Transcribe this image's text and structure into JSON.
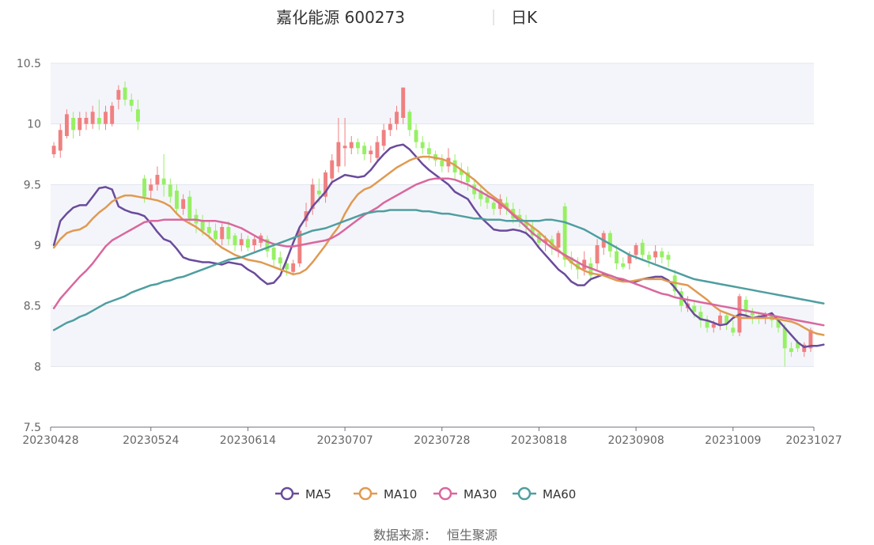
{
  "chart_data": {
    "type": "candlestick",
    "title": "嘉化能源 600273",
    "subtitle": "日K",
    "source_label": "数据来源：",
    "source_name": "恒生聚源",
    "ylim": [
      7.5,
      10.5
    ],
    "y_ticks": [
      "7.5",
      "8",
      "8.5",
      "9",
      "9.5",
      "10",
      "10.5"
    ],
    "x_ticks": [
      {
        "label": "20230428",
        "index": 0
      },
      {
        "label": "20230524",
        "index": 15
      },
      {
        "label": "20230614",
        "index": 30
      },
      {
        "label": "20230707",
        "index": 45
      },
      {
        "label": "20230728",
        "index": 60
      },
      {
        "label": "20230818",
        "index": 75
      },
      {
        "label": "20230908",
        "index": 90
      },
      {
        "label": "20231009",
        "index": 105
      },
      {
        "label": "20231027",
        "index": 119
      }
    ],
    "grid": true,
    "legend_position": "bottom",
    "colors": {
      "up": "#f08080",
      "down": "#96f064",
      "MA5": "#6a4b9c",
      "MA10": "#e09a52",
      "MA30": "#d9679e",
      "MA60": "#4f9ea0"
    },
    "candles": [
      [
        9.75,
        9.82,
        9.72,
        9.85
      ],
      [
        9.78,
        9.95,
        9.72,
        10.0
      ],
      [
        9.9,
        10.08,
        9.88,
        10.12
      ],
      [
        10.05,
        9.95,
        9.88,
        10.1
      ],
      [
        9.95,
        10.05,
        9.9,
        10.1
      ],
      [
        10.0,
        10.05,
        9.95,
        10.1
      ],
      [
        10.0,
        10.1,
        9.96,
        10.15
      ],
      [
        10.05,
        10.0,
        9.95,
        10.2
      ],
      [
        10.0,
        10.1,
        9.95,
        10.15
      ],
      [
        10.0,
        10.15,
        9.98,
        10.18
      ],
      [
        10.2,
        10.28,
        10.12,
        10.32
      ],
      [
        10.3,
        10.2,
        10.15,
        10.35
      ],
      [
        10.2,
        10.15,
        10.1,
        10.25
      ],
      [
        10.12,
        10.02,
        9.95,
        10.2
      ],
      [
        9.55,
        9.4,
        9.35,
        9.58
      ],
      [
        9.45,
        9.5,
        9.38,
        9.55
      ],
      [
        9.5,
        9.58,
        9.45,
        9.65
      ],
      [
        9.55,
        9.5,
        9.4,
        9.75
      ],
      [
        9.5,
        9.4,
        9.35,
        9.55
      ],
      [
        9.45,
        9.3,
        9.25,
        9.5
      ],
      [
        9.3,
        9.38,
        9.25,
        9.42
      ],
      [
        9.4,
        9.22,
        9.18,
        9.45
      ],
      [
        9.25,
        9.18,
        9.1,
        9.3
      ],
      [
        9.2,
        9.12,
        9.08,
        9.25
      ],
      [
        9.15,
        9.1,
        9.05,
        9.2
      ],
      [
        9.12,
        9.05,
        9.0,
        9.18
      ],
      [
        9.05,
        9.15,
        9.0,
        9.18
      ],
      [
        9.15,
        9.05,
        9.0,
        9.2
      ],
      [
        9.08,
        9.0,
        8.95,
        9.1
      ],
      [
        9.0,
        9.05,
        8.95,
        9.1
      ],
      [
        9.05,
        8.98,
        8.95,
        9.08
      ],
      [
        9.0,
        9.05,
        8.95,
        9.08
      ],
      [
        9.02,
        9.08,
        8.98,
        9.1
      ],
      [
        9.05,
        8.95,
        8.9,
        9.08
      ],
      [
        8.98,
        8.88,
        8.82,
        9.0
      ],
      [
        8.9,
        8.85,
        8.8,
        8.95
      ],
      [
        8.85,
        8.8,
        8.75,
        8.88
      ],
      [
        8.78,
        8.85,
        8.75,
        8.88
      ],
      [
        8.85,
        9.12,
        8.82,
        9.15
      ],
      [
        9.2,
        9.28,
        9.15,
        9.35
      ],
      [
        9.3,
        9.5,
        9.25,
        9.55
      ],
      [
        9.45,
        9.42,
        9.35,
        9.55
      ],
      [
        9.4,
        9.6,
        9.35,
        9.62
      ],
      [
        9.55,
        9.7,
        9.5,
        9.75
      ],
      [
        9.65,
        9.85,
        9.6,
        10.05
      ],
      [
        9.8,
        9.82,
        9.65,
        10.05
      ],
      [
        9.8,
        9.85,
        9.75,
        9.9
      ],
      [
        9.85,
        9.8,
        9.75,
        9.88
      ],
      [
        9.82,
        9.75,
        9.7,
        9.85
      ],
      [
        9.75,
        9.78,
        9.68,
        9.82
      ],
      [
        9.72,
        9.85,
        9.68,
        9.9
      ],
      [
        9.82,
        9.95,
        9.78,
        10.0
      ],
      [
        9.95,
        10.0,
        9.9,
        10.05
      ],
      [
        10.0,
        10.1,
        9.95,
        10.15
      ],
      [
        10.05,
        10.3,
        10.0,
        10.3
      ],
      [
        10.1,
        9.95,
        9.9,
        10.12
      ],
      [
        9.95,
        9.85,
        9.8,
        10.0
      ],
      [
        9.85,
        9.8,
        9.75,
        9.9
      ],
      [
        9.8,
        9.75,
        9.7,
        9.85
      ],
      [
        9.75,
        9.7,
        9.65,
        9.78
      ],
      [
        9.7,
        9.65,
        9.6,
        9.75
      ],
      [
        9.65,
        9.72,
        9.6,
        9.8
      ],
      [
        9.7,
        9.6,
        9.55,
        9.75
      ],
      [
        9.62,
        9.58,
        9.5,
        9.68
      ],
      [
        9.6,
        9.52,
        9.45,
        9.65
      ],
      [
        9.5,
        9.42,
        9.38,
        9.55
      ],
      [
        9.45,
        9.38,
        9.32,
        9.5
      ],
      [
        9.4,
        9.35,
        9.3,
        9.45
      ],
      [
        9.35,
        9.3,
        9.25,
        9.4
      ],
      [
        9.3,
        9.38,
        9.25,
        9.42
      ],
      [
        9.35,
        9.3,
        9.25,
        9.4
      ],
      [
        9.3,
        9.22,
        9.18,
        9.35
      ],
      [
        9.25,
        9.2,
        9.15,
        9.3
      ],
      [
        9.2,
        9.15,
        9.1,
        9.25
      ],
      [
        9.15,
        9.08,
        9.05,
        9.2
      ],
      [
        9.1,
        9.02,
        8.98,
        9.12
      ],
      [
        9.02,
        9.05,
        8.95,
        9.08
      ],
      [
        9.05,
        8.98,
        8.92,
        9.08
      ],
      [
        8.98,
        9.1,
        8.9,
        9.12
      ],
      [
        9.32,
        8.88,
        8.82,
        9.35
      ],
      [
        8.9,
        8.85,
        8.8,
        8.95
      ],
      [
        8.85,
        8.8,
        8.72,
        8.9
      ],
      [
        8.8,
        8.88,
        8.75,
        8.95
      ],
      [
        8.85,
        8.75,
        8.7,
        8.9
      ],
      [
        8.85,
        9.0,
        8.8,
        9.05
      ],
      [
        8.98,
        9.1,
        8.92,
        9.12
      ],
      [
        9.1,
        8.95,
        8.9,
        9.12
      ],
      [
        8.95,
        8.85,
        8.8,
        9.0
      ],
      [
        8.85,
        8.82,
        8.8,
        8.9
      ],
      [
        8.85,
        8.92,
        8.8,
        8.95
      ],
      [
        8.92,
        9.0,
        8.88,
        9.02
      ],
      [
        9.02,
        8.92,
        8.88,
        9.05
      ],
      [
        8.92,
        8.88,
        8.82,
        8.95
      ],
      [
        8.9,
        8.95,
        8.85,
        9.0
      ],
      [
        8.95,
        8.9,
        8.85,
        8.98
      ],
      [
        8.92,
        8.88,
        8.82,
        8.95
      ],
      [
        8.75,
        8.62,
        8.58,
        8.8
      ],
      [
        8.62,
        8.5,
        8.45,
        8.65
      ],
      [
        8.48,
        8.52,
        8.45,
        8.58
      ],
      [
        8.5,
        8.45,
        8.4,
        8.55
      ],
      [
        8.45,
        8.38,
        8.32,
        8.5
      ],
      [
        8.38,
        8.32,
        8.28,
        8.42
      ],
      [
        8.32,
        8.35,
        8.28,
        8.38
      ],
      [
        8.35,
        8.42,
        8.3,
        8.45
      ],
      [
        8.42,
        8.35,
        8.3,
        8.45
      ],
      [
        8.32,
        8.28,
        8.25,
        8.38
      ],
      [
        8.28,
        8.58,
        8.25,
        8.6
      ],
      [
        8.55,
        8.45,
        8.4,
        8.58
      ],
      [
        8.45,
        8.42,
        8.35,
        8.48
      ],
      [
        8.42,
        8.4,
        8.35,
        8.45
      ],
      [
        8.4,
        8.42,
        8.35,
        8.45
      ],
      [
        8.42,
        8.38,
        8.32,
        8.45
      ],
      [
        8.38,
        8.32,
        8.28,
        8.4
      ],
      [
        8.32,
        8.15,
        8.0,
        8.35
      ],
      [
        8.15,
        8.12,
        8.08,
        8.2
      ],
      [
        8.2,
        8.15,
        8.12,
        8.22
      ],
      [
        8.12,
        8.18,
        8.08,
        8.2
      ],
      [
        8.15,
        8.3,
        8.12,
        8.32
      ]
    ],
    "series": [
      {
        "name": "MA5",
        "values": [
          9.0,
          9.2,
          9.26,
          9.31,
          9.33,
          9.33,
          9.4,
          9.47,
          9.48,
          9.46,
          9.32,
          9.29,
          9.27,
          9.26,
          9.24,
          9.18,
          9.11,
          9.05,
          9.03,
          8.97,
          8.9,
          8.88,
          8.87,
          8.86,
          8.86,
          8.85,
          8.84,
          8.86,
          8.85,
          8.84,
          8.8,
          8.77,
          8.72,
          8.68,
          8.69,
          8.75,
          8.88,
          9.02,
          9.15,
          9.23,
          9.32,
          9.38,
          9.44,
          9.52,
          9.55,
          9.58,
          9.57,
          9.56,
          9.57,
          9.62,
          9.69,
          9.75,
          9.8,
          9.82,
          9.83,
          9.79,
          9.73,
          9.67,
          9.62,
          9.58,
          9.54,
          9.5,
          9.44,
          9.41,
          9.38,
          9.3,
          9.23,
          9.18,
          9.13,
          9.12,
          9.12,
          9.13,
          9.12,
          9.1,
          9.05,
          8.98,
          8.92,
          8.86,
          8.8,
          8.76,
          8.7,
          8.67,
          8.67,
          8.72,
          8.74,
          8.76,
          8.75,
          8.73,
          8.71,
          8.7,
          8.7,
          8.72,
          8.73,
          8.74,
          8.74,
          8.71,
          8.65,
          8.58,
          8.5,
          8.43,
          8.39,
          8.38,
          8.36,
          8.34,
          8.35,
          8.4,
          8.43,
          8.42,
          8.4,
          8.41,
          8.42,
          8.44,
          8.38,
          8.32,
          8.26,
          8.2,
          8.16,
          8.17,
          8.17,
          8.18
        ]
      },
      {
        "name": "MA10",
        "values": [
          8.98,
          9.05,
          9.1,
          9.12,
          9.13,
          9.16,
          9.22,
          9.27,
          9.31,
          9.36,
          9.39,
          9.41,
          9.41,
          9.4,
          9.39,
          9.38,
          9.37,
          9.35,
          9.32,
          9.26,
          9.21,
          9.18,
          9.15,
          9.11,
          9.07,
          9.02,
          8.98,
          8.95,
          8.92,
          8.9,
          8.88,
          8.87,
          8.86,
          8.84,
          8.82,
          8.8,
          8.78,
          8.76,
          8.77,
          8.8,
          8.86,
          8.93,
          9.0,
          9.08,
          9.15,
          9.26,
          9.35,
          9.42,
          9.46,
          9.48,
          9.52,
          9.56,
          9.6,
          9.64,
          9.67,
          9.7,
          9.72,
          9.73,
          9.73,
          9.72,
          9.71,
          9.69,
          9.66,
          9.62,
          9.58,
          9.54,
          9.49,
          9.44,
          9.4,
          9.36,
          9.31,
          9.26,
          9.22,
          9.19,
          9.15,
          9.11,
          9.06,
          9.01,
          8.96,
          8.91,
          8.86,
          8.82,
          8.79,
          8.77,
          8.76,
          8.75,
          8.73,
          8.71,
          8.7,
          8.7,
          8.71,
          8.72,
          8.72,
          8.72,
          8.72,
          8.7,
          8.69,
          8.68,
          8.67,
          8.63,
          8.59,
          8.55,
          8.5,
          8.46,
          8.44,
          8.42,
          8.4,
          8.4,
          8.4,
          8.4,
          8.4,
          8.4,
          8.39,
          8.38,
          8.37,
          8.35,
          8.32,
          8.29,
          8.27,
          8.26
        ]
      },
      {
        "name": "MA30",
        "values": [
          8.48,
          8.56,
          8.62,
          8.68,
          8.74,
          8.79,
          8.85,
          8.92,
          8.99,
          9.04,
          9.07,
          9.1,
          9.13,
          9.16,
          9.19,
          9.2,
          9.2,
          9.21,
          9.21,
          9.21,
          9.21,
          9.21,
          9.21,
          9.2,
          9.2,
          9.2,
          9.19,
          9.18,
          9.16,
          9.14,
          9.11,
          9.08,
          9.05,
          9.03,
          9.01,
          9.0,
          8.99,
          8.99,
          9.0,
          9.01,
          9.02,
          9.03,
          9.04,
          9.06,
          9.09,
          9.13,
          9.17,
          9.21,
          9.25,
          9.28,
          9.31,
          9.35,
          9.38,
          9.41,
          9.44,
          9.47,
          9.5,
          9.52,
          9.54,
          9.55,
          9.55,
          9.55,
          9.54,
          9.52,
          9.5,
          9.47,
          9.44,
          9.41,
          9.38,
          9.34,
          9.3,
          9.25,
          9.2,
          9.15,
          9.1,
          9.06,
          9.02,
          8.98,
          8.95,
          8.92,
          8.89,
          8.86,
          8.83,
          8.81,
          8.79,
          8.77,
          8.75,
          8.73,
          8.72,
          8.7,
          8.68,
          8.66,
          8.64,
          8.62,
          8.6,
          8.59,
          8.57,
          8.56,
          8.55,
          8.54,
          8.53,
          8.52,
          8.51,
          8.5,
          8.49,
          8.48,
          8.47,
          8.46,
          8.45,
          8.44,
          8.43,
          8.42,
          8.41,
          8.4,
          8.39,
          8.38,
          8.37,
          8.36,
          8.35,
          8.34
        ]
      },
      {
        "name": "MA60",
        "values": [
          8.3,
          8.33,
          8.36,
          8.38,
          8.41,
          8.43,
          8.46,
          8.49,
          8.52,
          8.54,
          8.56,
          8.58,
          8.61,
          8.63,
          8.65,
          8.67,
          8.68,
          8.7,
          8.71,
          8.73,
          8.74,
          8.76,
          8.78,
          8.8,
          8.82,
          8.84,
          8.86,
          8.88,
          8.89,
          8.9,
          8.92,
          8.94,
          8.96,
          8.98,
          9.0,
          9.02,
          9.04,
          9.06,
          9.08,
          9.1,
          9.12,
          9.13,
          9.14,
          9.16,
          9.18,
          9.2,
          9.22,
          9.24,
          9.26,
          9.27,
          9.28,
          9.28,
          9.29,
          9.29,
          9.29,
          9.29,
          9.29,
          9.28,
          9.28,
          9.27,
          9.26,
          9.26,
          9.25,
          9.24,
          9.23,
          9.22,
          9.22,
          9.21,
          9.21,
          9.21,
          9.2,
          9.2,
          9.2,
          9.2,
          9.2,
          9.2,
          9.21,
          9.21,
          9.2,
          9.19,
          9.17,
          9.15,
          9.13,
          9.1,
          9.07,
          9.04,
          9.01,
          8.98,
          8.95,
          8.92,
          8.9,
          8.88,
          8.86,
          8.84,
          8.82,
          8.8,
          8.78,
          8.76,
          8.74,
          8.72,
          8.71,
          8.7,
          8.69,
          8.68,
          8.67,
          8.66,
          8.65,
          8.64,
          8.63,
          8.62,
          8.61,
          8.6,
          8.59,
          8.58,
          8.57,
          8.56,
          8.55,
          8.54,
          8.53,
          8.52
        ]
      }
    ]
  }
}
